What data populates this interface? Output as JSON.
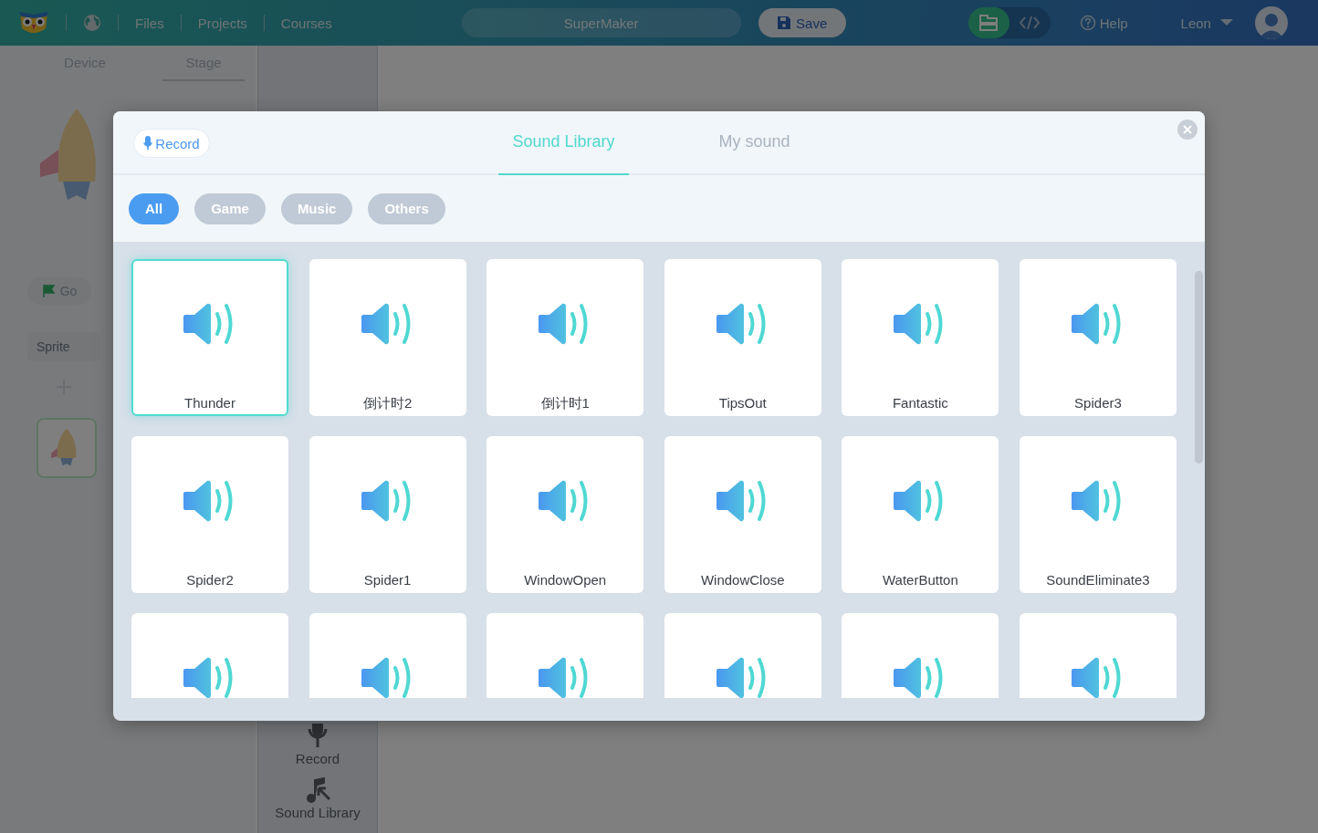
{
  "top_bar": {
    "nav": [
      "Files",
      "Projects",
      "Courses"
    ],
    "project_name": "SuperMaker",
    "save": "Save",
    "modes": [
      {
        "kind": "blocks",
        "selected": true
      },
      {
        "kind": "code",
        "selected": false
      }
    ],
    "help": "Help",
    "user": "Leon"
  },
  "stage_panel": {
    "tabs": [
      {
        "label": "Device",
        "selected": false
      },
      {
        "label": "Stage",
        "selected": true
      }
    ],
    "go": "Go",
    "sprite_tab": "Sprite"
  },
  "side_menu": [
    {
      "kind": "record",
      "label": "Record"
    },
    {
      "kind": "library",
      "label": "Sound Library"
    }
  ],
  "dialog": {
    "record": "Record",
    "tabs": [
      {
        "label": "Sound Library",
        "selected": true
      },
      {
        "label": "My sound",
        "selected": false
      }
    ],
    "filters": [
      {
        "label": "All",
        "selected": true
      },
      {
        "label": "Game",
        "selected": false
      },
      {
        "label": "Music",
        "selected": false
      },
      {
        "label": "Others",
        "selected": false
      }
    ],
    "sounds": [
      {
        "name": "Thunder",
        "selected": true
      },
      {
        "name": "倒计时2",
        "selected": false
      },
      {
        "name": "倒计时1",
        "selected": false
      },
      {
        "name": "TipsOut",
        "selected": false
      },
      {
        "name": "Fantastic",
        "selected": false
      },
      {
        "name": "Spider3",
        "selected": false
      },
      {
        "name": "Spider2",
        "selected": false
      },
      {
        "name": "Spider1",
        "selected": false
      },
      {
        "name": "WindowOpen",
        "selected": false
      },
      {
        "name": "WindowClose",
        "selected": false
      },
      {
        "name": "WaterButton",
        "selected": false
      },
      {
        "name": "SoundEliminate3",
        "selected": false
      },
      {
        "selected": false
      },
      {
        "selected": false
      },
      {
        "selected": false
      },
      {
        "selected": false
      },
      {
        "selected": false
      },
      {
        "selected": false
      }
    ]
  }
}
